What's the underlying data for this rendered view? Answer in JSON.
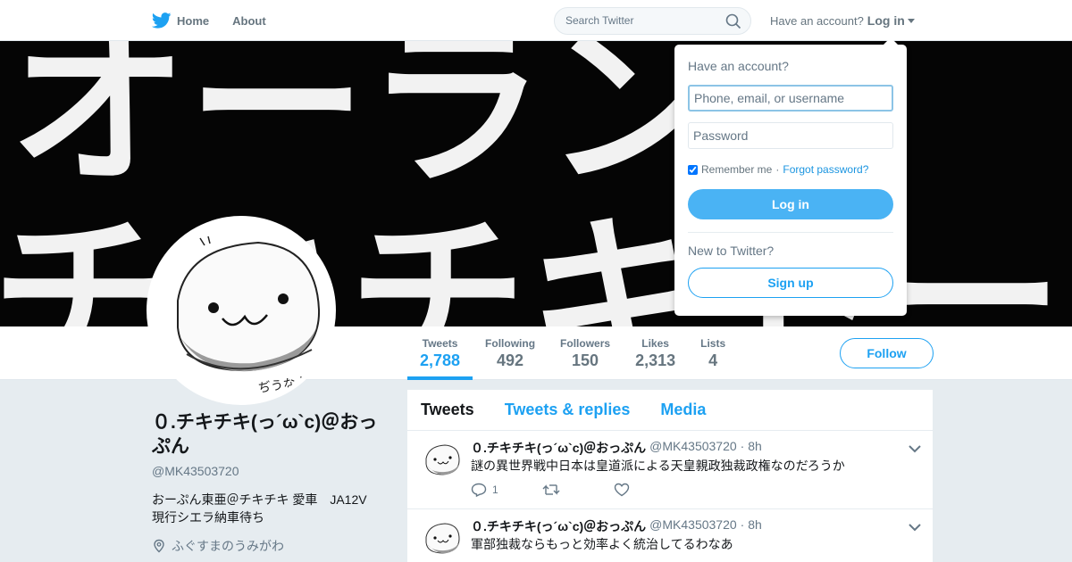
{
  "nav": {
    "home_label": "Home",
    "about_label": "About",
    "search_placeholder": "Search Twitter",
    "have_account": "Have an account?",
    "login_label": "Log in"
  },
  "banner": {
    "line1": "オーラン",
    "line2": "チキチキトーム"
  },
  "profile": {
    "name": "０.チキチキ(っ´ω`c)＠おっぷん",
    "handle": "@MK43503720",
    "bio": "おーぷん東亜＠チキチキ 愛車　JA12V\n現行シエラ納車待ち",
    "location": "ふぐすまのうみがわ",
    "avatar_signature": "ぢうなよ"
  },
  "stats": [
    {
      "label": "Tweets",
      "value": "2,788"
    },
    {
      "label": "Following",
      "value": "492"
    },
    {
      "label": "Followers",
      "value": "150"
    },
    {
      "label": "Likes",
      "value": "2,313"
    },
    {
      "label": "Lists",
      "value": "4"
    }
  ],
  "follow_label": "Follow",
  "tabs": [
    "Tweets",
    "Tweets & replies",
    "Media"
  ],
  "tweets": [
    {
      "name": "０.チキチキ(っ´ω`c)＠おっぷん",
      "handle": "@MK43503720",
      "time": "· 8h",
      "text": "謎の異世界戦中日本は皇道派による天皇親政独裁政権なのだろうか",
      "reply_count": "1"
    },
    {
      "name": "０.チキチキ(っ´ω`c)＠おっぷん",
      "handle": "@MK43503720",
      "time": "· 8h",
      "text": "軍部独裁ならもっと効率よく統治してるわなあ",
      "reply_count": ""
    }
  ],
  "login_dropdown": {
    "title": "Have an account?",
    "username_placeholder": "Phone, email, or username",
    "password_placeholder": "Password",
    "remember_label": "Remember me",
    "separator": "·",
    "forgot_label": "Forgot password?",
    "login_button": "Log in",
    "new_label": "New to Twitter?",
    "signup_button": "Sign up"
  },
  "colors": {
    "accent": "#1da1f2",
    "background": "#e6ecf0",
    "banner": "#050505"
  }
}
